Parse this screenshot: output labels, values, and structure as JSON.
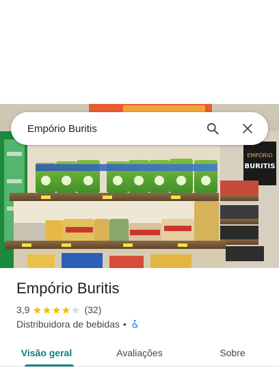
{
  "search": {
    "value": "Empório Buritis"
  },
  "place": {
    "name": "Empório Buritis",
    "rating": "3,9",
    "rating_stars": 3.9,
    "review_count": "(32)",
    "category": "Distribuidora de bebidas",
    "separator": "•"
  },
  "photo": {
    "sign_brand_top": "EMPÓRIO",
    "sign_brand_bottom": "BURITIS"
  },
  "tabs": [
    {
      "label": "Visão geral",
      "active": true
    },
    {
      "label": "Avaliações",
      "active": false
    },
    {
      "label": "Sobre",
      "active": false
    }
  ],
  "colors": {
    "accent": "#0b7f80",
    "star": "#fbbc04",
    "star_empty": "#dadce0",
    "accessibility": "#1a73e8"
  },
  "icons": {
    "search": "search-icon",
    "close": "close-icon",
    "accessibility": "wheelchair-icon"
  }
}
